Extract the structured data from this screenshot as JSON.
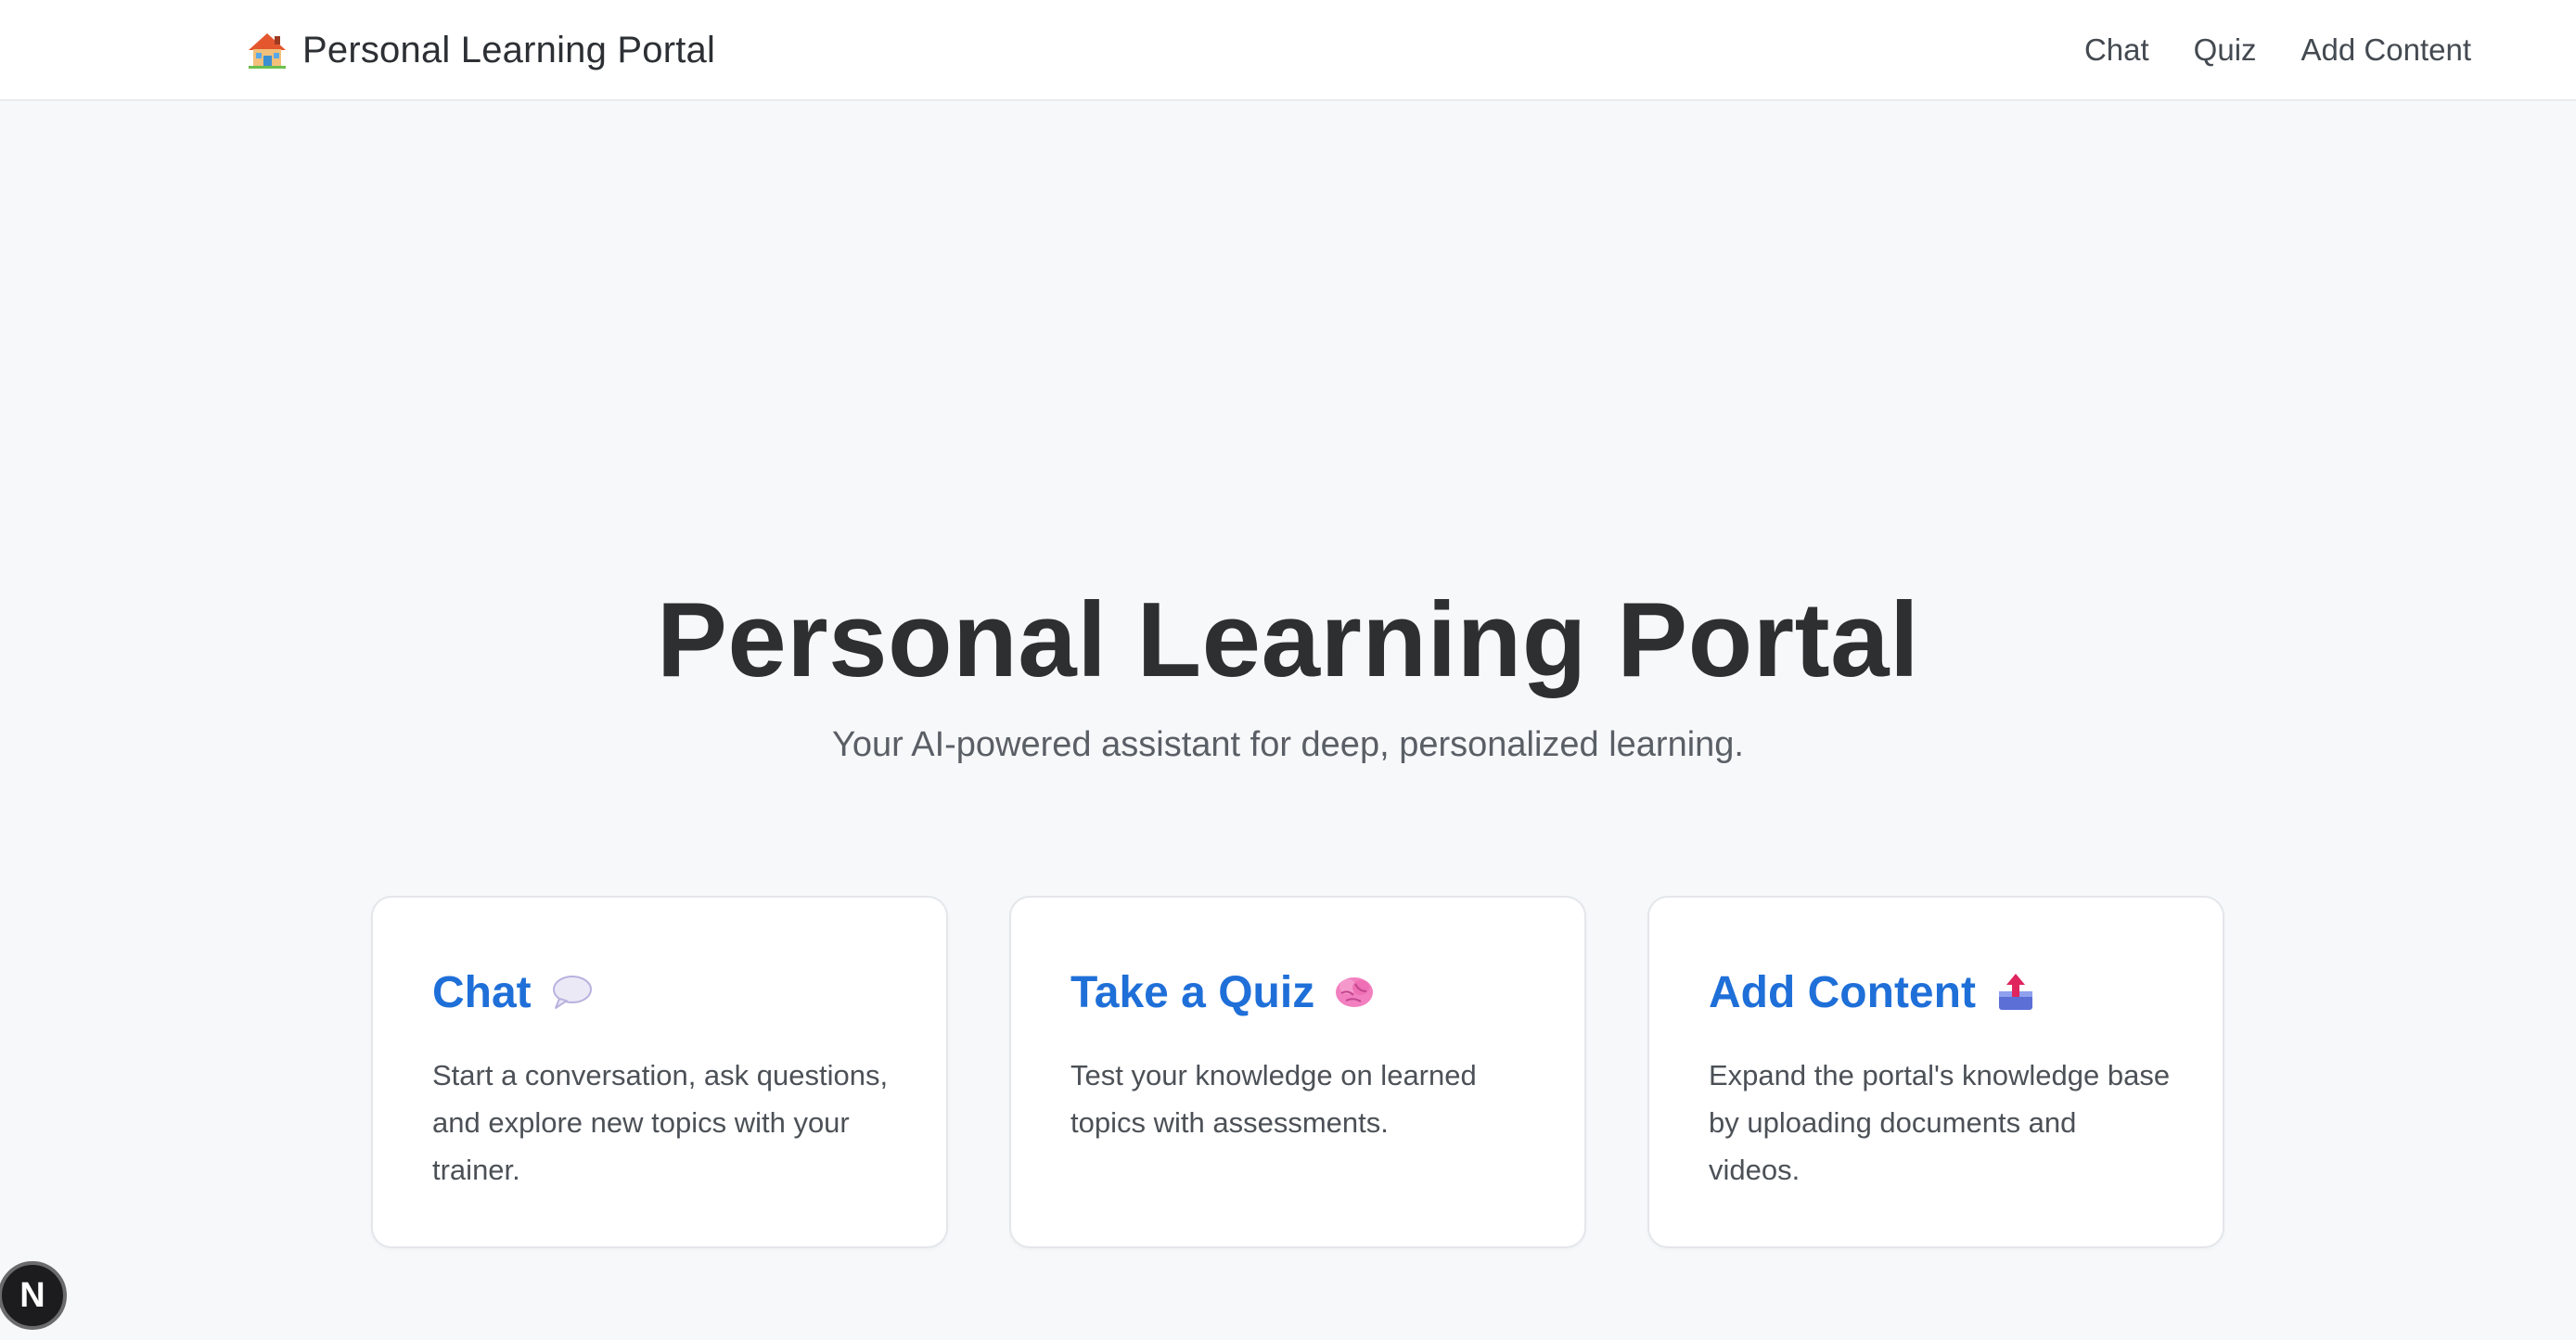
{
  "navbar": {
    "brand_title": "Personal Learning Portal",
    "brand_icon": "house-icon",
    "links": [
      {
        "label": "Chat"
      },
      {
        "label": "Quiz"
      },
      {
        "label": "Add Content"
      }
    ]
  },
  "hero": {
    "title": "Personal Learning Portal",
    "subtitle": "Your AI-powered assistant for deep, personalized learning."
  },
  "cards": [
    {
      "title": "Chat",
      "icon": "speech-bubble-icon",
      "description": "Start a conversation, ask questions, and explore new topics with your trainer."
    },
    {
      "title": "Take a Quiz",
      "icon": "brain-icon",
      "description": "Test your knowledge on learned topics with assessments."
    },
    {
      "title": "Add Content",
      "icon": "outbox-tray-icon",
      "description": "Expand the portal's knowledge base by uploading documents and videos."
    }
  ],
  "dev_badge": {
    "label": "N"
  },
  "colors": {
    "accent": "#1f6fd8",
    "background": "#f7f8fa",
    "card_background": "#ffffff",
    "heading": "#2d2f31"
  }
}
